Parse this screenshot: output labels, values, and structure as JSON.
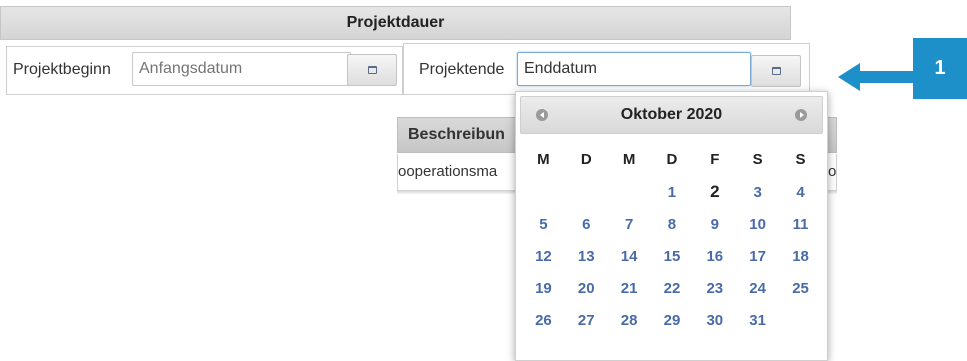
{
  "header": {
    "title": "Projektdauer"
  },
  "start": {
    "label": "Projektbeginn",
    "placeholder": "Anfangsdatum"
  },
  "end": {
    "label": "Projektende",
    "value": "Enddatum"
  },
  "table": {
    "header": "Beschreibun",
    "row_text": "ooperationsma",
    "row_right": "o"
  },
  "datepicker": {
    "title": "Oktober 2020",
    "weekdays": [
      "M",
      "D",
      "M",
      "D",
      "F",
      "S",
      "S"
    ],
    "weeks": [
      [
        "",
        "",
        "",
        "1",
        "2",
        "3",
        "4"
      ],
      [
        "5",
        "6",
        "7",
        "8",
        "9",
        "10",
        "11"
      ],
      [
        "12",
        "13",
        "14",
        "15",
        "16",
        "17",
        "18"
      ],
      [
        "19",
        "20",
        "21",
        "22",
        "23",
        "24",
        "25"
      ],
      [
        "26",
        "27",
        "28",
        "29",
        "30",
        "31",
        ""
      ]
    ],
    "today": "2"
  },
  "callout": {
    "number": "1",
    "color": "#1d8fc9"
  },
  "icons": {
    "calendar": "calendar-icon",
    "prev": "chevron-left-icon",
    "next": "chevron-right-icon",
    "arrow": "arrow-left-icon"
  }
}
